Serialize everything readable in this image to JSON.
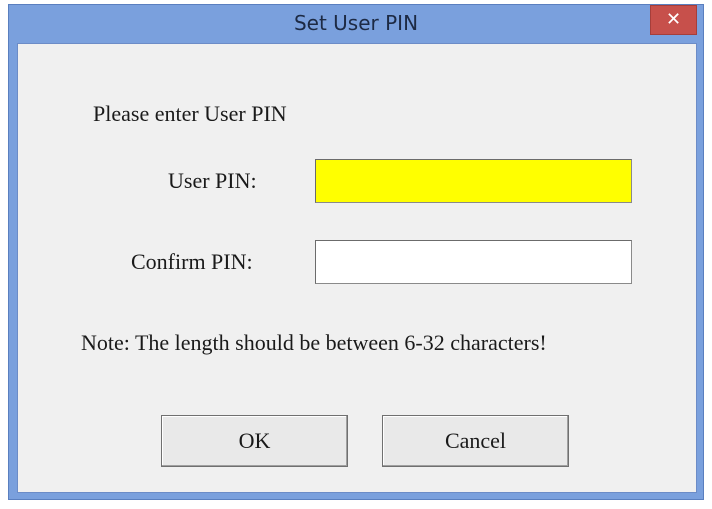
{
  "window": {
    "title": "Set User PIN",
    "close_glyph": "✕"
  },
  "dialog": {
    "prompt": "Please enter User PIN",
    "user_pin_label": "User PIN:",
    "user_pin_value": "",
    "confirm_pin_label": "Confirm PIN:",
    "confirm_pin_value": "",
    "note": "Note: The length should be between 6-32 characters!",
    "ok_label": "OK",
    "cancel_label": "Cancel"
  },
  "colors": {
    "titlebar": "#7aa0dd",
    "close_button": "#c7504b",
    "user_pin_field_bg": "#ffff00",
    "confirm_pin_field_bg": "#ffffff",
    "client_bg": "#f0f0f0"
  },
  "icons": {
    "close": "close-icon"
  }
}
